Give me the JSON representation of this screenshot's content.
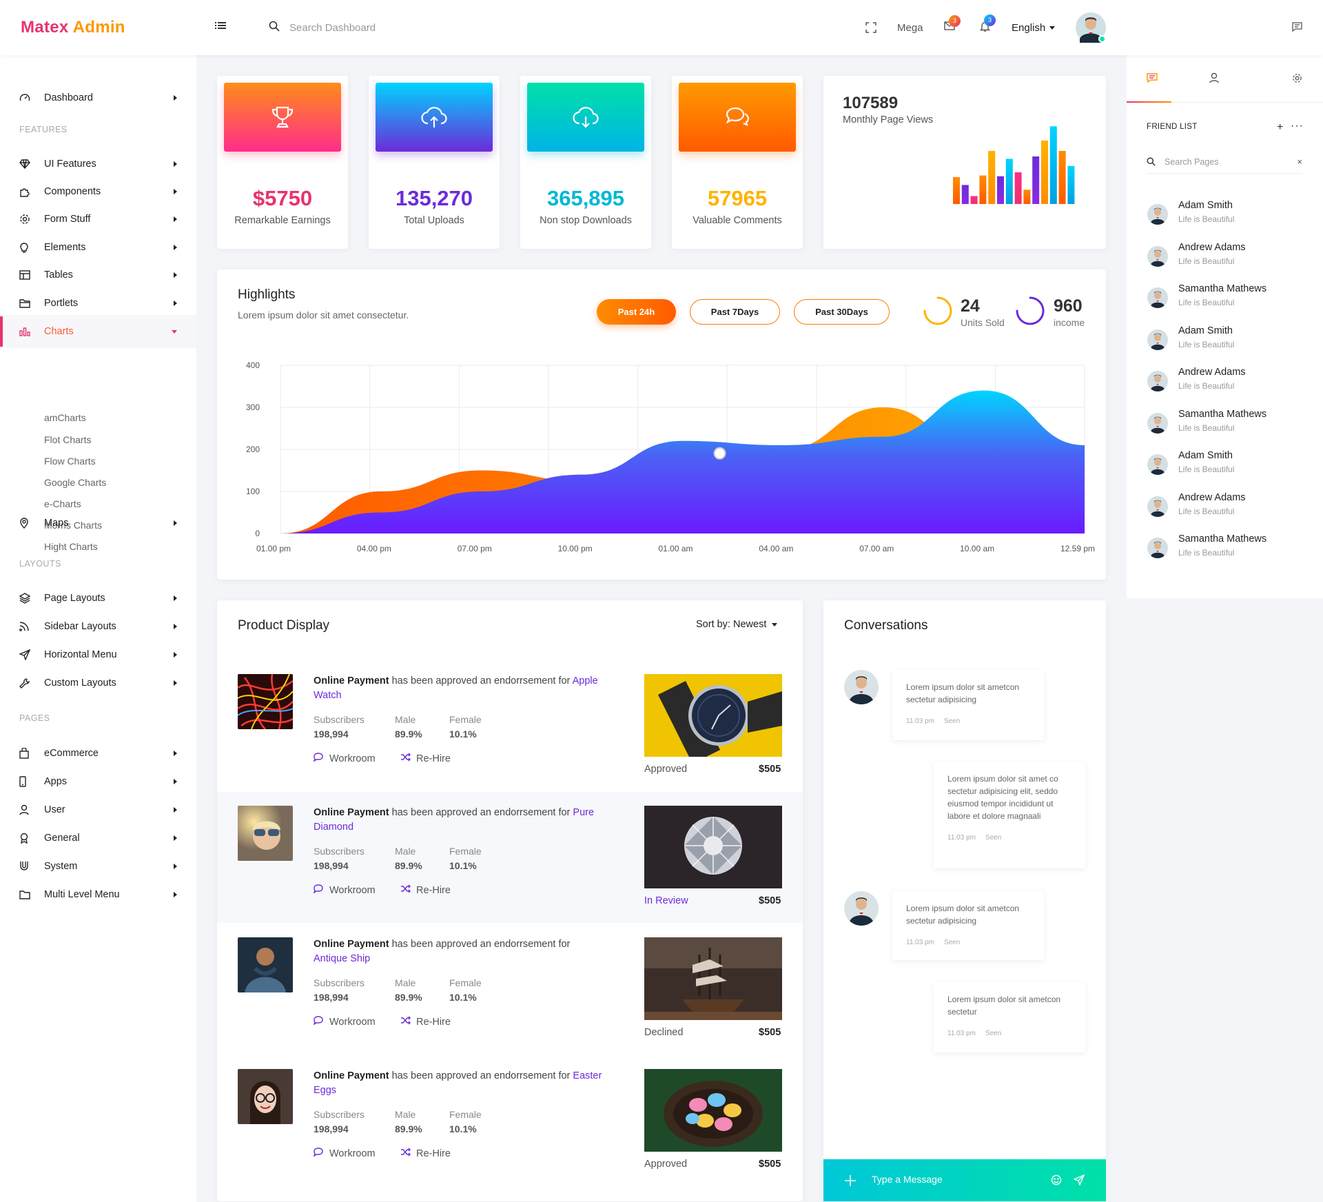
{
  "brand": {
    "part1": "Matex",
    "part2": "Admin"
  },
  "topbar": {
    "search_placeholder": "Search Dashboard",
    "mega": "Mega",
    "mail_badge": "3",
    "bell_badge": "3",
    "language": "English"
  },
  "sidebar": {
    "dashboard": "Dashboard",
    "features_head": "FEATURES",
    "ui_features": "UI Features",
    "components": "Components",
    "form_stuff": "Form Stuff",
    "elements": "Elements",
    "tables": "Tables",
    "portlets": "Portlets",
    "charts": "Charts",
    "charts_sub": [
      "amCharts",
      "Flot Charts",
      "Flow Charts",
      "Google Charts",
      "e-Charts",
      "Morris Charts",
      "Hight Charts"
    ],
    "maps": "Maps",
    "layouts_head": "LAYOUTS",
    "page_layouts": "Page Layouts",
    "sidebar_layouts": "Sidebar Layouts",
    "horizontal_menu": "Horizontal Menu",
    "custom_layouts": "Custom Layouts",
    "pages_head": "PAGES",
    "ecommerce": "eCommerce",
    "apps": "Apps",
    "user": "User",
    "general": "General",
    "system": "System",
    "multi_level": "Multi Level Menu"
  },
  "stats": [
    {
      "value": "$5750",
      "label": "Remarkable Earnings",
      "color": "#e8336d"
    },
    {
      "value": "135,270",
      "label": "Total Uploads",
      "color": "#6c2bd9"
    },
    {
      "value": "365,895",
      "label": "Non stop Downloads",
      "color": "#00b8d4"
    },
    {
      "value": "57965",
      "label": "Valuable Comments",
      "color": "#ffb300"
    }
  ],
  "monthly": {
    "value": "107589",
    "label": "Monthly Page Views",
    "bars": [
      0.34,
      0.24,
      0.1,
      0.36,
      0.67,
      0.35,
      0.57,
      0.4,
      0.18,
      0.6,
      0.8,
      0.98,
      0.67,
      0.48
    ]
  },
  "highlights": {
    "title": "Highlights",
    "subtitle": "Lorem ipsum dolor sit amet consectetur.",
    "btn_24h": "Past 24h",
    "btn_7d": "Past 7Days",
    "btn_30d": "Past 30Days",
    "units_value": "24",
    "units_label": "Units Sold",
    "income_value": "960",
    "income_label": "income"
  },
  "chart_data": {
    "type": "area",
    "x": [
      "01.00 pm",
      "04.00 pm",
      "07.00 pm",
      "10.00 pm",
      "01.00 am",
      "04.00 am",
      "07.00 am",
      "10.00 am",
      "12.59 pm"
    ],
    "yticks": [
      0,
      100,
      200,
      300,
      400
    ],
    "ylim": [
      0,
      400
    ],
    "series": [
      {
        "values": [
          0,
          100,
          150,
          125,
          220,
          200,
          300,
          190,
          140
        ]
      },
      {
        "values": [
          0,
          50,
          100,
          140,
          220,
          210,
          230,
          340,
          210
        ]
      }
    ]
  },
  "products": {
    "title": "Product Display",
    "sort_label": "Sort by: Newest",
    "items": [
      {
        "lead": "Online Payment",
        "text": " has been approved an endorrsement for ",
        "link": "Apple Watch",
        "subs_h": "Subscribers",
        "subs": "198,994",
        "male_h": "Male",
        "male": "89.9%",
        "female_h": "Female",
        "female": "10.1%",
        "workroom": "Workroom",
        "rehire": "Re-Hire",
        "status": "Approved",
        "price": "$505"
      },
      {
        "lead": "Online Payment",
        "text": " has been approved an endorrsement for ",
        "link": "Pure Diamond",
        "subs_h": "Subscribers",
        "subs": "198,994",
        "male_h": "Male",
        "male": "89.9%",
        "female_h": "Female",
        "female": "10.1%",
        "workroom": "Workroom",
        "rehire": "Re-Hire",
        "status": "In Review",
        "price": "$505"
      },
      {
        "lead": "Online Payment",
        "text": " has been approved an endorrsement for ",
        "link": "Antique Ship",
        "subs_h": "Subscribers",
        "subs": "198,994",
        "male_h": "Male",
        "male": "89.9%",
        "female_h": "Female",
        "female": "10.1%",
        "workroom": "Workroom",
        "rehire": "Re-Hire",
        "status": "Declined",
        "price": "$505"
      },
      {
        "lead": "Online Payment",
        "text": " has been approved an endorrsement for ",
        "link": "Easter Eggs",
        "subs_h": "Subscribers",
        "subs": "198,994",
        "male_h": "Male",
        "male": "89.9%",
        "female_h": "Female",
        "female": "10.1%",
        "workroom": "Workroom",
        "rehire": "Re-Hire",
        "status": "Approved",
        "price": "$505"
      }
    ]
  },
  "conversations": {
    "title": "Conversations",
    "messages": [
      {
        "text": "Lorem ipsum dolor sit ametcon sectetur adipisicing",
        "time": "11.03 pm",
        "seen": "Seen"
      },
      {
        "text": "Lorem ipsum dolor sit amet co sectetur adipisicing elit, seddo eiusmod tempor incididunt ut labore et dolore magnaali",
        "time": "11.03 pm",
        "seen": "Seen"
      },
      {
        "text": "Lorem ipsum dolor sit ametcon sectetur adipisicing",
        "time": "11.03 pm",
        "seen": "Seen"
      },
      {
        "text": "Lorem ipsum dolor sit ametcon sectetur",
        "time": "11.03 pm",
        "seen": "Seen"
      }
    ],
    "input_placeholder": "Type a Message"
  },
  "right_panel": {
    "friend_list_title": "FRIEND LIST",
    "search_placeholder": "Search Pages",
    "friends": [
      {
        "name": "Adam Smith",
        "status": "Life is Beautiful"
      },
      {
        "name": "Andrew Adams",
        "status": "Life is Beautiful"
      },
      {
        "name": "Samantha Mathews",
        "status": "Life is Beautiful"
      },
      {
        "name": "Adam Smith",
        "status": "Life is Beautiful"
      },
      {
        "name": "Andrew Adams",
        "status": "Life is Beautiful"
      },
      {
        "name": "Samantha Mathews",
        "status": "Life is Beautiful"
      },
      {
        "name": "Adam Smith",
        "status": "Life is Beautiful"
      },
      {
        "name": "Andrew Adams",
        "status": "Life is Beautiful"
      },
      {
        "name": "Samantha Mathews",
        "status": "Life is Beautiful"
      }
    ]
  }
}
